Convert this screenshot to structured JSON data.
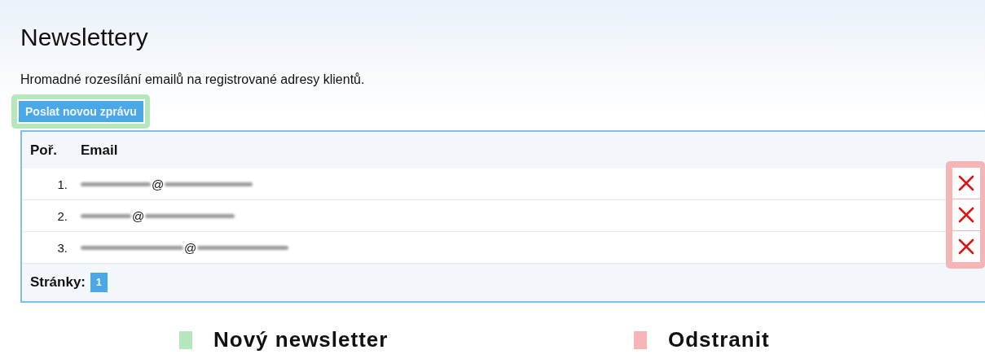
{
  "title": "Newslettery",
  "description": "Hromadné rozesílání emailů na registrované adresy klientů.",
  "new_message_button": "Poslat novou zprávu",
  "table": {
    "columns": [
      "Poř.",
      "Email"
    ],
    "rows": [
      {
        "number": "1.",
        "email": "@"
      },
      {
        "number": "2.",
        "email": "@"
      },
      {
        "number": "3.",
        "email": "@"
      }
    ]
  },
  "pagination": {
    "label": "Stránky:",
    "pages": [
      {
        "label": "1",
        "selected": true
      }
    ]
  },
  "legend": [
    {
      "label": "Nový newsletter",
      "color": "#b5e6bc"
    },
    {
      "label": "Odstranit",
      "color": "#f6b5b5"
    }
  ]
}
